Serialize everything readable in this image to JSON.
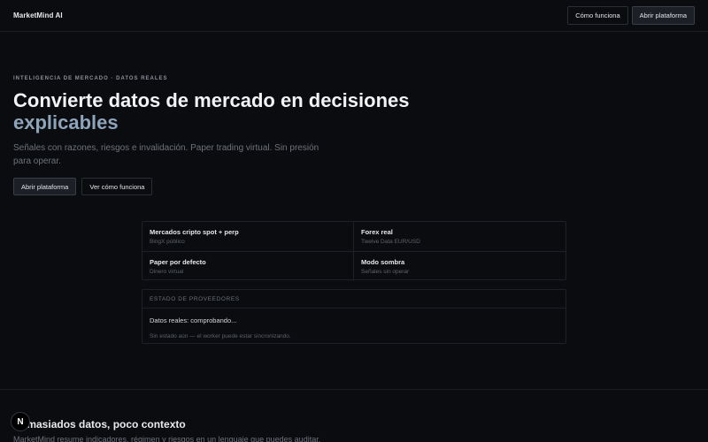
{
  "header": {
    "brand": "MarketMind AI",
    "nav_how": "Cómo funciona",
    "nav_open": "Abrir plataforma"
  },
  "hero": {
    "eyebrow": "INTELIGENCIA DE MERCADO · DATOS REALES",
    "title_line1": "Convierte datos de mercado en decisiones",
    "title_line2": "explicables",
    "subtitle": "Señales con razones, riesgos e invalidación. Paper trading virtual. Sin presión para operar.",
    "cta_primary": "Abrir plataforma",
    "cta_secondary": "Ver cómo funciona"
  },
  "features": [
    {
      "title": "Mercados cripto spot + perp",
      "subtitle": "BingX público"
    },
    {
      "title": "Forex real",
      "subtitle": "Twelve Data EUR/USD"
    },
    {
      "title": "Paper por defecto",
      "subtitle": "Dinero virtual"
    },
    {
      "title": "Modo sombra",
      "subtitle": "Señales sin operar"
    }
  ],
  "status": {
    "heading": "ESTADO DE PROVEEDORES",
    "line": "Datos reales: comprobando...",
    "note": "Sin estado aún — el worker puede estar sincronizando."
  },
  "section2": {
    "title": "Demasiados datos, poco contexto",
    "text": "MarketMind resume indicadores, régimen y riesgos en un lenguaje que puedes auditar."
  },
  "badge": {
    "letter": "N"
  },
  "colors": {
    "background": "#0b0c0f",
    "accent": "#8ea4bb",
    "border": "#1d2026"
  }
}
